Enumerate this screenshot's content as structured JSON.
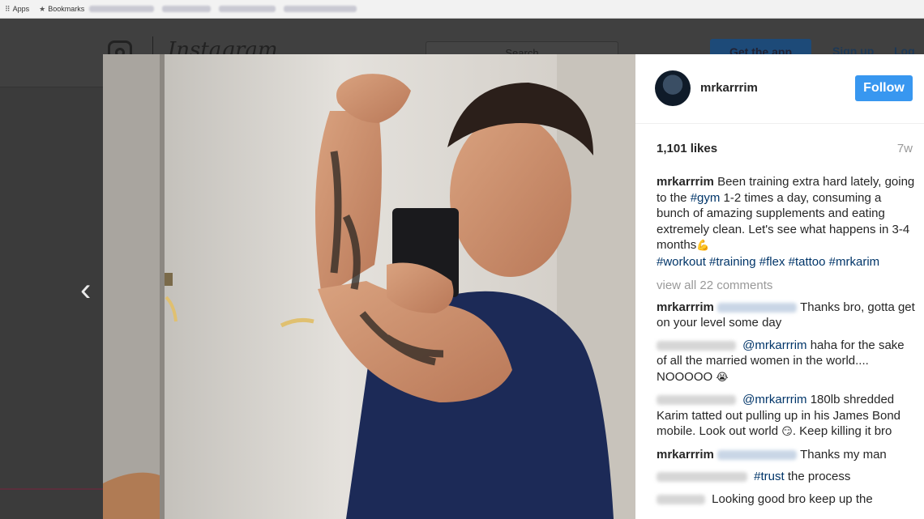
{
  "browser": {
    "bookmarks_bar": {
      "apps_label": "Apps",
      "bookmarks_label": "Bookmarks"
    }
  },
  "instagram_header": {
    "wordmark": "Instagram",
    "search_placeholder": "Search",
    "get_app_label": "Get the app",
    "signup_label": "Sign up",
    "login_label": "Log"
  },
  "post": {
    "username": "mrkarrrim",
    "follow_label": "Follow",
    "likes": "1,101 likes",
    "age": "7w",
    "caption_user": "mrkarrrim",
    "caption_1": "Been training extra hard lately, going to the ",
    "caption_tag_gym": "#gym",
    "caption_2": " 1-2 times a day, consuming a bunch of amazing supplements and eating extremely clean. Let's see what happens in 3-4 months",
    "caption_emoji": "💪",
    "hashtags": [
      "#workout",
      "#training",
      "#flex",
      "#tattoo",
      "#mrkarim"
    ],
    "view_all_comments": "view all 22 comments",
    "comments": {
      "c1_user": "mrkarrrim",
      "c1_text": "Thanks bro, gotta get on your level some day",
      "c2_mention": "@mrkarrrim",
      "c2_text": " haha for the sake of all the married women in the world.... NOOOOO ",
      "c2_emoji": "😭",
      "c3_mention": "@mrkarrrim",
      "c3_text": " 180lb shredded Karim tatted out pulling up in his James Bond mobile. Look out world ",
      "c3_emoji": "😏",
      "c3_text_end": ". Keep killing it bro",
      "c4_user": "mrkarrrim",
      "c4_text": "Thanks my man",
      "c5_tag": "#trust",
      "c5_text": " the process",
      "c6_text": "Looking good bro keep up the"
    }
  },
  "colors": {
    "follow_button": "#3897f0",
    "hashtag": "#003569",
    "overlay_background": "#3b3b3b",
    "muted_text": "#999999"
  },
  "icons": {
    "prev": "chevron-left-icon",
    "apps": "apps-grid-icon",
    "bookmark": "star-icon"
  }
}
